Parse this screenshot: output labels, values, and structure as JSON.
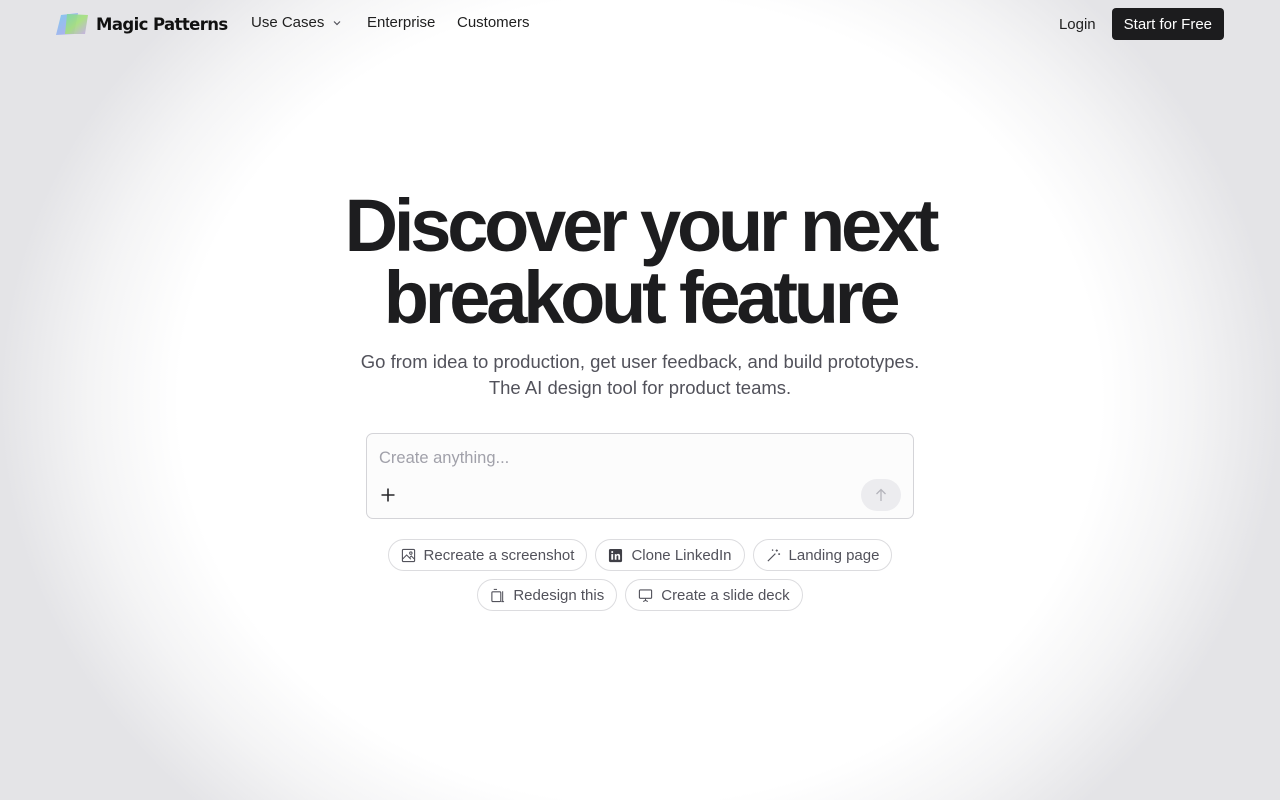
{
  "brand": {
    "name": "Magic Patterns"
  },
  "nav": {
    "links": [
      {
        "label": "Use Cases",
        "has_dropdown": true
      },
      {
        "label": "Enterprise"
      },
      {
        "label": "Customers"
      }
    ],
    "login": "Login",
    "cta": "Start for Free"
  },
  "hero": {
    "title_line1": "Discover your next",
    "title_line2": "breakout feature",
    "subtitle_line1": "Go from idea to production, get user feedback, and build prototypes.",
    "subtitle_line2": "The AI design tool for product teams."
  },
  "prompt": {
    "placeholder": "Create anything...",
    "value": "",
    "add_icon": "plus-icon",
    "send_icon": "arrow-up-icon"
  },
  "suggestions": [
    {
      "label": "Recreate a screenshot",
      "icon": "image-icon"
    },
    {
      "label": "Clone LinkedIn",
      "icon": "linkedin-icon"
    },
    {
      "label": "Landing page",
      "icon": "magic-wand-icon"
    },
    {
      "label": "Redesign this",
      "icon": "redesign-icon"
    },
    {
      "label": "Create a slide deck",
      "icon": "presentation-icon"
    }
  ],
  "colors": {
    "primary_button": "#1c1c1e",
    "text": "#1f1f1f",
    "muted_text": "#52525b",
    "border": "#dcdcdf"
  }
}
